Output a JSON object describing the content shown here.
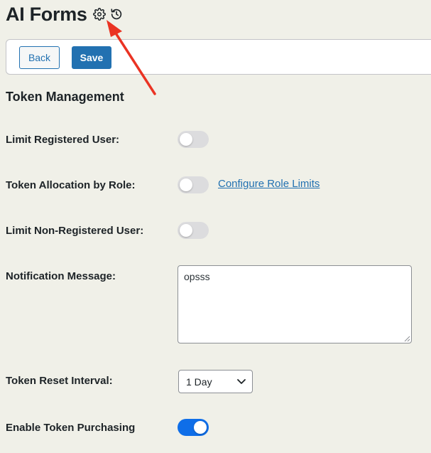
{
  "header": {
    "title": "AI Forms",
    "icons": [
      "gear-icon",
      "history-icon"
    ]
  },
  "toolbar": {
    "back_label": "Back",
    "save_label": "Save"
  },
  "section": {
    "title": "Token Management"
  },
  "settings": {
    "limit_registered": {
      "label": "Limit Registered User:",
      "enabled": false
    },
    "allocation_by_role": {
      "label": "Token Allocation by Role:",
      "enabled": false,
      "link": "Configure Role Limits"
    },
    "limit_non_registered": {
      "label": "Limit Non-Registered User:",
      "enabled": false
    },
    "notification": {
      "label": "Notification Message:",
      "value": "opsss"
    },
    "reset_interval": {
      "label": "Token Reset Interval:",
      "selected": "1 Day"
    },
    "token_purchasing": {
      "label": "Enable Token Purchasing",
      "enabled": true
    }
  },
  "colors": {
    "accent": "#2271b1",
    "toggle_on": "#0f6ee8",
    "annotation_arrow": "#ea3323"
  }
}
